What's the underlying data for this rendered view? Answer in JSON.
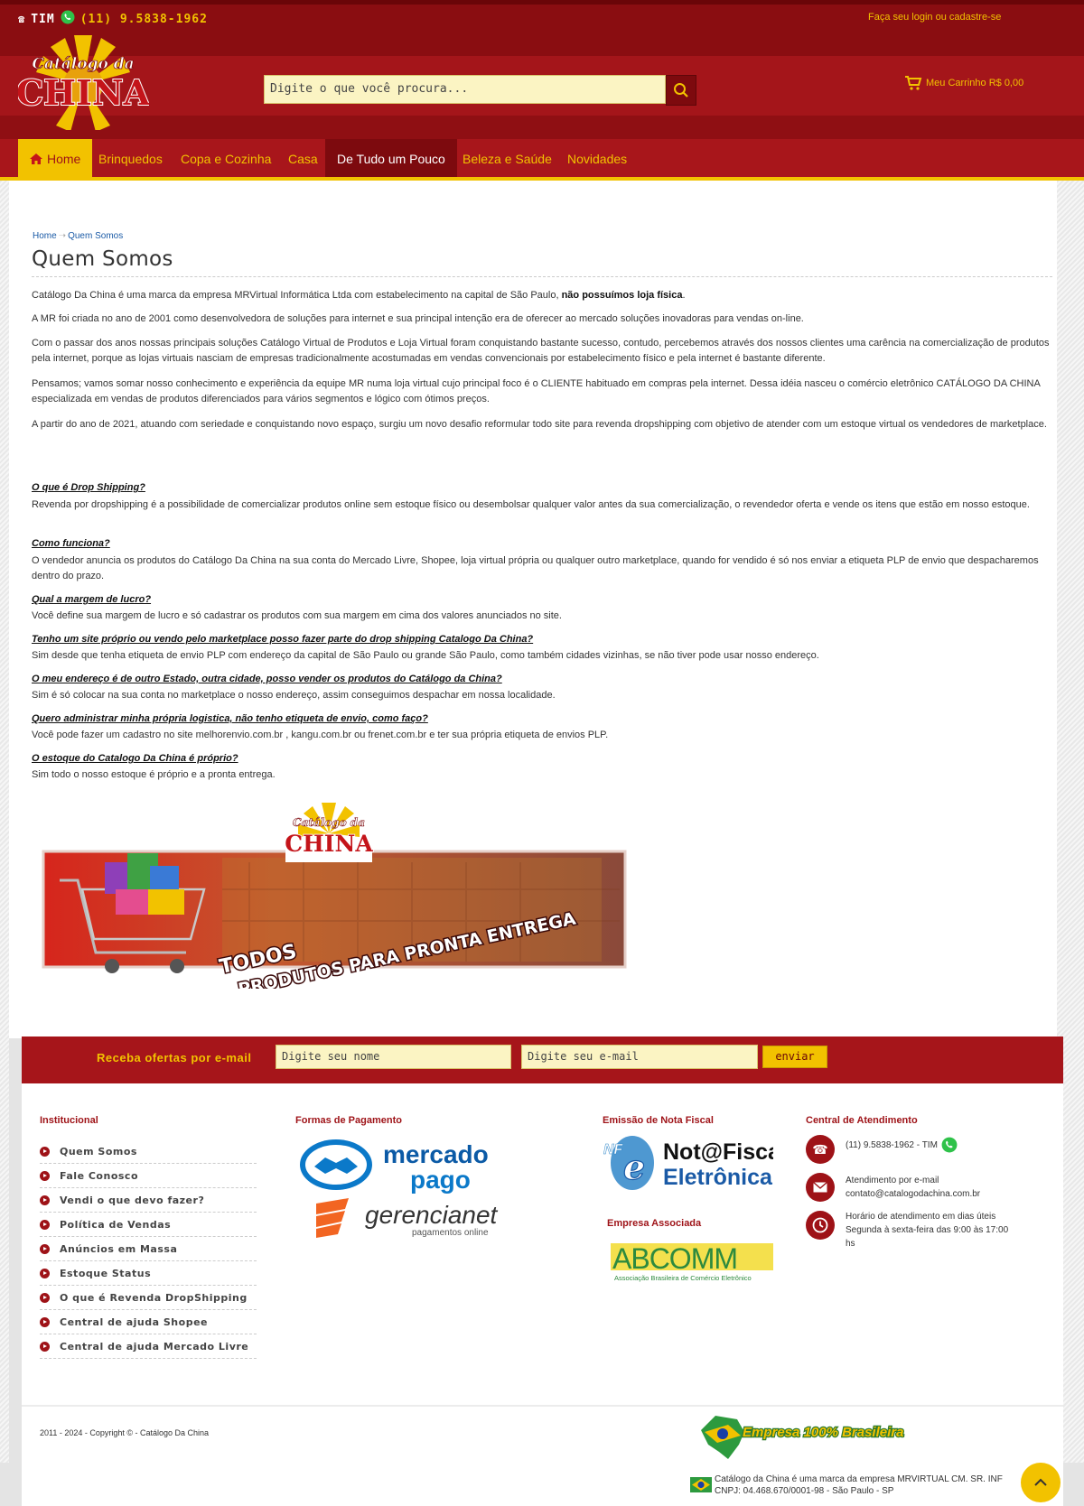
{
  "header": {
    "carrier": "TIM",
    "phone": "(11) 9.5838-1962",
    "login_text": "Faça seu login ou cadastre-se",
    "logo_line1": "Catálogo da",
    "logo_line2": "CHINA",
    "search_placeholder": "Digite o que você procura...",
    "cart_label": "Meu Carrinho R$ 0,00"
  },
  "nav": {
    "items": [
      {
        "label": "Home"
      },
      {
        "label": "Brinquedos"
      },
      {
        "label": "Copa e Cozinha"
      },
      {
        "label": "Casa"
      },
      {
        "label": "De Tudo um Pouco"
      },
      {
        "label": "Beleza e Saúde"
      },
      {
        "label": "Novidades"
      }
    ]
  },
  "breadcrumb": {
    "home": "Home",
    "current": "Quem Somos"
  },
  "page": {
    "title": "Quem Somos",
    "p1_a": "Catálogo Da China é uma marca da empresa  MRVirtual Informática Ltda com estabelecimento na capital de São Paulo, ",
    "p1_b": "não possuímos loja física",
    "p1_c": ".",
    "p2": "A MR foi criada no ano de 2001 como desenvolvedora de soluções para internet e sua principal intenção era de oferecer ao mercado soluções inovadoras para vendas on-line.",
    "p3": "Com o passar dos anos nossas principais soluções Catálogo Virtual de Produtos e Loja Virtual foram conquistando bastante sucesso, contudo, percebemos através dos nossos clientes uma carência na comercialização de produtos pela internet, porque as lojas virtuais nasciam de empresas tradicionalmente acostumadas em vendas convencionais por estabelecimento físico e pela internet é bastante diferente.",
    "p4": "Pensamos; vamos somar nosso conhecimento e experiência da equipe MR numa loja virtual cujo principal foco é o CLIENTE habituado em compras pela internet. Dessa idéia nasceu o comércio eletrônico CATÁLOGO DA CHINA especializada em vendas de produtos diferenciados para vários segmentos e lógico com ótimos preços.",
    "p5": "A partir do ano de 2021, atuando com seriedade e conquistando novo espaço, surgiu um novo desafio reformular todo site para revenda dropshipping com objetivo de atender com um estoque virtual os vendedores de marketplace.",
    "faq": [
      {
        "q": "O que é Drop Shipping?",
        "a": "Revenda por dropshipping é a possibilidade de comercializar produtos online sem estoque físico ou desembolsar qualquer valor antes da sua comercialização, o revendedor oferta e vende os itens que estão em nosso estoque."
      },
      {
        "q": "Como funciona?",
        "a": "O vendedor anuncia os produtos do Catálogo Da China na sua conta do Mercado Livre, Shopee, loja virtual própria ou qualquer outro marketplace, quando for vendido é só nos enviar a etiqueta PLP de envio que despacharemos dentro do prazo."
      },
      {
        "q": "Qual a margem de lucro?",
        "a": "Você define sua margem de lucro e só cadastrar os produtos com sua margem em cima dos valores anunciados no site."
      },
      {
        "q": "Tenho um site próprio ou vendo pelo marketplace posso fazer parte do drop shipping Catalogo Da China?",
        "a": "Sim desde que tenha etiqueta de envio PLP com endereço da capital de São Paulo ou grande São Paulo, como também cidades vizinhas, se não tiver pode usar nosso endereço."
      },
      {
        "q": "O meu endereço é de outro Estado, outra cidade, posso vender os produtos do Catálogo da China?",
        "a": "Sim é só colocar na sua conta no marketplace o nosso endereço, assim conseguimos despachar em nossa localidade."
      },
      {
        "q": "Quero administrar minha própria logistica, não tenho etiqueta de envio, como faço?",
        "a": "Você pode fazer um cadastro no site melhorenvio.com.br , kangu.com.br ou frenet.com.br e ter sua própria etiqueta de envios PLP."
      },
      {
        "q": "O estoque do Catalogo Da China é próprio?",
        "a": "Sim todo o nosso estoque é próprio e a pronta entrega."
      }
    ]
  },
  "banner": {
    "line1": "TODOS",
    "line2": "PRODUTOS PARA PRONTA ENTREGA",
    "logo_line1": "Catálogo da",
    "logo_line2": "CHINA"
  },
  "newsletter": {
    "label": "Receba ofertas por e-mail",
    "name_placeholder": "Digite seu nome",
    "email_placeholder": "Digite seu e-mail",
    "button": "enviar"
  },
  "footer": {
    "institucional_title": "Institucional",
    "institucional": [
      "Quem Somos",
      "Fale Conosco",
      "Vendi o que devo fazer?",
      "Política de Vendas",
      "Anúncios em Massa",
      "Estoque Status",
      "O que é Revenda DropShipping",
      "Central de ajuda Shopee",
      "Central de ajuda Mercado Livre"
    ],
    "pagamento_title": "Formas de Pagamento",
    "mercadopago_1": "mercado",
    "mercadopago_2": "pago",
    "gerencianet_1": "gerencianet",
    "gerencianet_2": "pagamentos online",
    "nota_title": "Emissão de Nota Fiscal",
    "nota_1": "Not@Fiscal",
    "nota_2": "Eletrônica",
    "nota_nfe": "NF",
    "empresa_title": "Empresa Associada",
    "abcomm": "ABCOMM",
    "abcomm_sub": "Associação Brasileira de Comércio Eletrônico",
    "atendimento_title": "Central de Atendimento",
    "phone_line": "(11) 9.5838-1962 - TIM",
    "email_line1": "Atendimento por e-mail",
    "email_line2": "contato@catalogodachina.com.br",
    "hours_line1": "Horário de atendimento em dias úteis",
    "hours_line2": "Segunda à sexta-feira das 9:00 às 17:00",
    "hours_line3": "hs",
    "copyright": "2011 - 2024 - Copyright © - Catálogo Da China",
    "brasileira": "Empresa 100% Brasileira",
    "company_line1": "Catálogo da China é uma marca da empresa MRVIRTUAL CM. SR. INF",
    "company_line2": "CNPJ: 04.468.670/0001-98 - São Paulo - SP"
  },
  "colors": {
    "brand_red": "#9e1217",
    "brand_yellow": "#f2c200",
    "dark_red": "#7d0a0e"
  }
}
